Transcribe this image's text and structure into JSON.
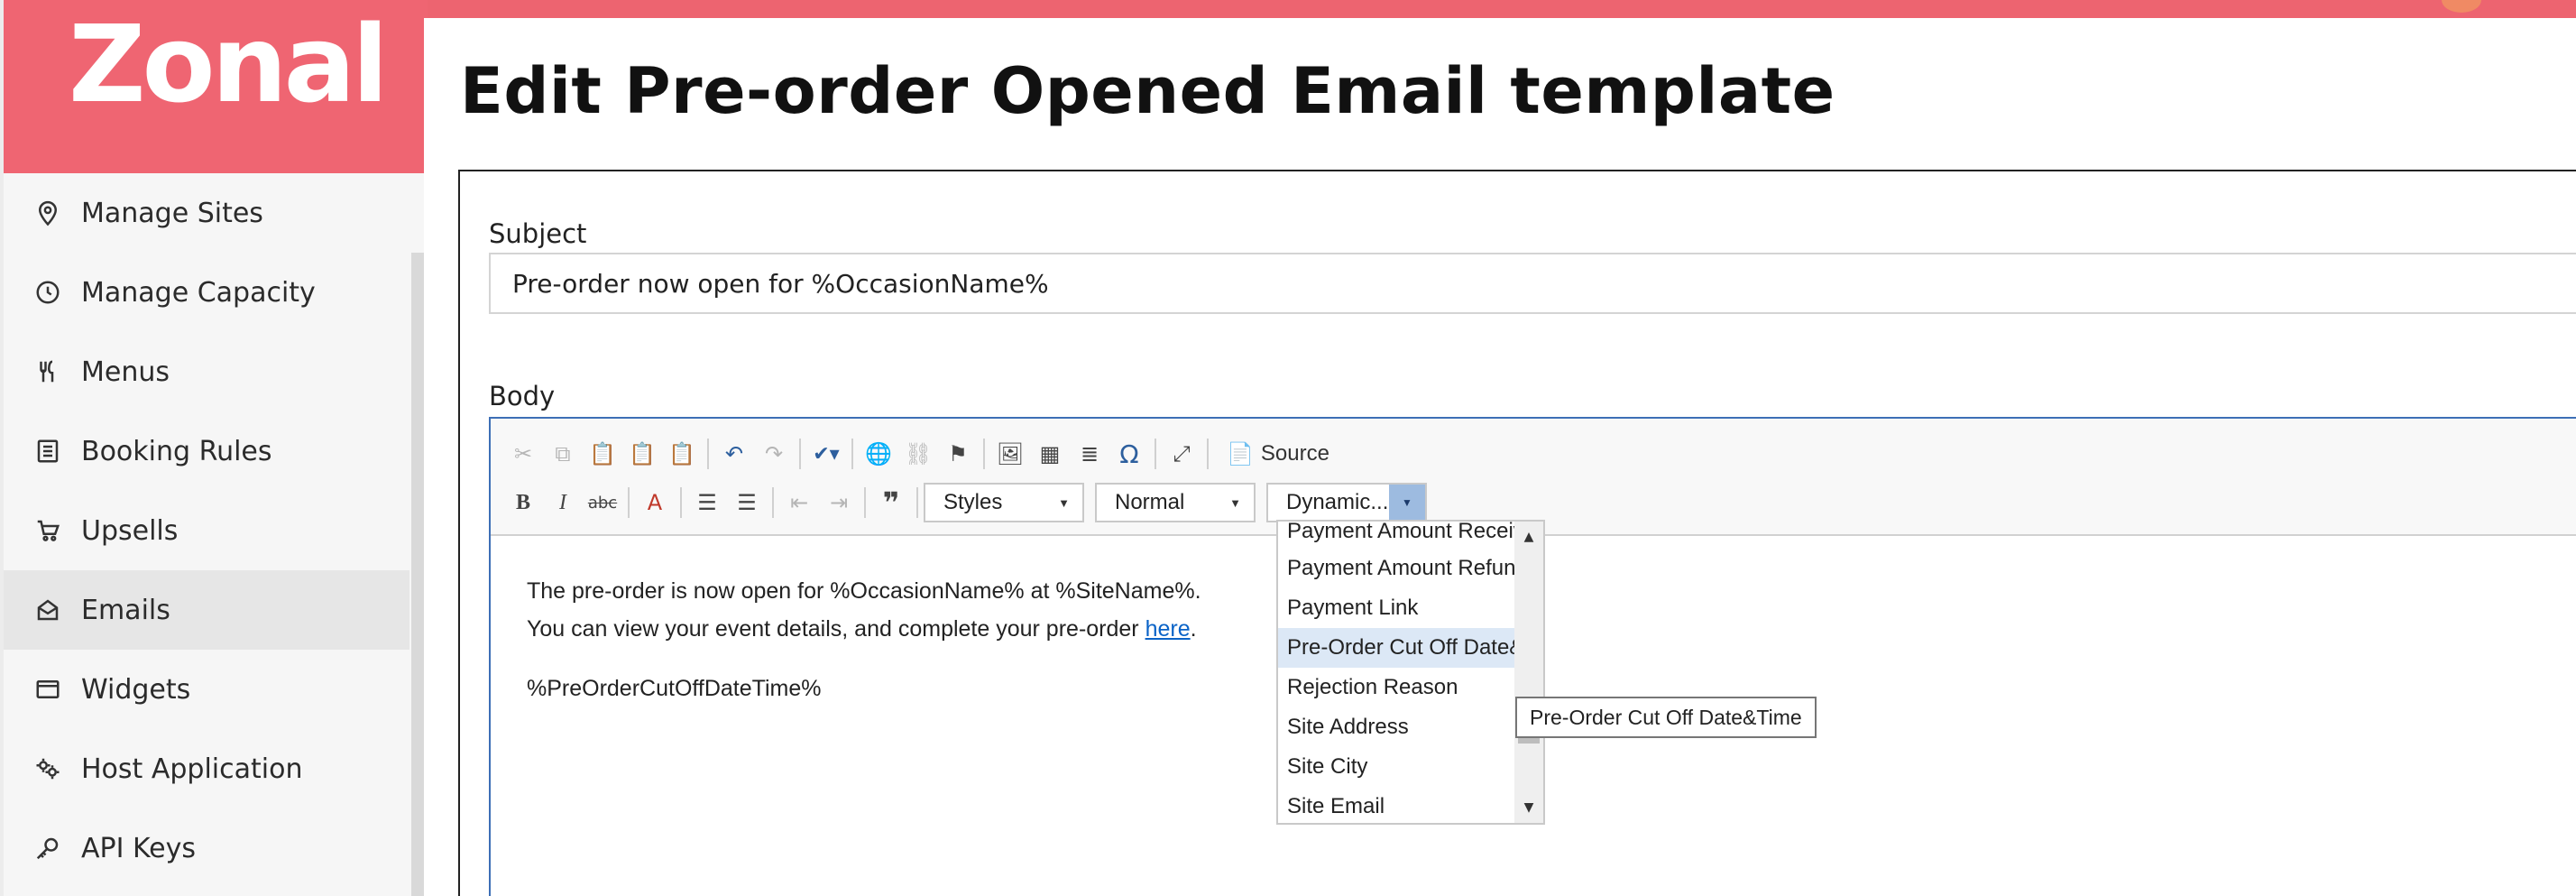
{
  "app": {
    "logo_text": "Zonal",
    "brand_color": "#ef6572"
  },
  "sidebar": {
    "items": [
      {
        "label": "Manage Sites",
        "icon": "map-pin-icon"
      },
      {
        "label": "Manage Capacity",
        "icon": "clock-icon"
      },
      {
        "label": "Menus",
        "icon": "cutlery-icon"
      },
      {
        "label": "Booking Rules",
        "icon": "checklist-icon"
      },
      {
        "label": "Upsells",
        "icon": "cart-icon"
      },
      {
        "label": "Emails",
        "icon": "envelope-icon",
        "active": true
      },
      {
        "label": "Widgets",
        "icon": "window-icon"
      },
      {
        "label": "Host Application",
        "icon": "gears-icon"
      },
      {
        "label": "API Keys",
        "icon": "key-icon"
      }
    ]
  },
  "page": {
    "title": "Edit Pre-order Opened Email template"
  },
  "form": {
    "subject_label": "Subject",
    "subject_value": "Pre-order now open for %OccasionName%",
    "body_label": "Body"
  },
  "editor": {
    "source_label": "Source",
    "styles_label": "Styles",
    "format_label": "Normal",
    "dynamic_label": "Dynamic...",
    "content": {
      "line1": "The pre-order is now open for %OccasionName% at %SiteName%.",
      "line2_before": "You can view your event details, and complete your pre-order ",
      "line2_link": "here",
      "line2_after": ".",
      "line3": "%PreOrderCutOffDateTime%"
    }
  },
  "dropdown": {
    "items": [
      "Payment Amount Receiv",
      "Payment Amount Refund",
      "Payment Link",
      "Pre-Order Cut Off Date&",
      "Rejection Reason",
      "Site Address",
      "Site City",
      "Site Email"
    ],
    "highlighted_index": 3
  },
  "tooltip": {
    "text": "Pre-Order Cut Off Date&Time"
  }
}
